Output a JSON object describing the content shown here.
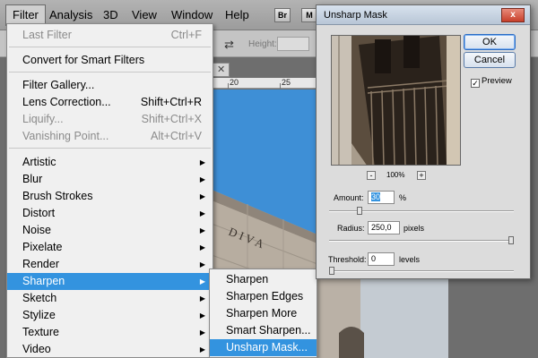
{
  "menubar": {
    "items": [
      "Filter",
      "Analysis",
      "3D",
      "View",
      "Window",
      "Help"
    ],
    "br_label": "Br",
    "mb_label": "M"
  },
  "options_bar": {
    "height_label": "Height:"
  },
  "document": {
    "ruler_marks": [
      "20",
      "25"
    ]
  },
  "filter_menu": {
    "last_filter": {
      "label": "Last Filter",
      "shortcut": "Ctrl+F"
    },
    "convert_smart": "Convert for Smart Filters",
    "filter_gallery": "Filter Gallery...",
    "lens_correction": {
      "label": "Lens Correction...",
      "shortcut": "Shift+Ctrl+R"
    },
    "liquify": {
      "label": "Liquify...",
      "shortcut": "Shift+Ctrl+X"
    },
    "vanishing_point": {
      "label": "Vanishing Point...",
      "shortcut": "Alt+Ctrl+V"
    },
    "categories": [
      "Artistic",
      "Blur",
      "Brush Strokes",
      "Distort",
      "Noise",
      "Pixelate",
      "Render",
      "Sharpen",
      "Sketch",
      "Stylize",
      "Texture",
      "Video"
    ],
    "highlighted": "Sharpen"
  },
  "sharpen_submenu": {
    "items": [
      "Sharpen",
      "Sharpen Edges",
      "Sharpen More",
      "Smart Sharpen...",
      "Unsharp Mask..."
    ],
    "highlighted": "Unsharp Mask..."
  },
  "dialog": {
    "title": "Unsharp Mask",
    "close_label": "x",
    "ok_label": "OK",
    "cancel_label": "Cancel",
    "preview_label": "Preview",
    "preview_checked": true,
    "zoom_minus": "-",
    "zoom_plus": "+",
    "zoom_level": "100%",
    "amount": {
      "label": "Amount:",
      "value": "30",
      "unit": "%",
      "slider_fraction": 0.06
    },
    "radius": {
      "label": "Radius:",
      "value": "250,0",
      "unit": "pixels",
      "slider_fraction": 1.0
    },
    "threshold": {
      "label": "Threshold:",
      "value": "0",
      "unit": "levels",
      "slider_fraction": 0.0
    }
  },
  "colors": {
    "menu_highlight": "#3393df",
    "sky_blue": "#3d91d8",
    "dialog_bg": "#dcdcdc"
  }
}
